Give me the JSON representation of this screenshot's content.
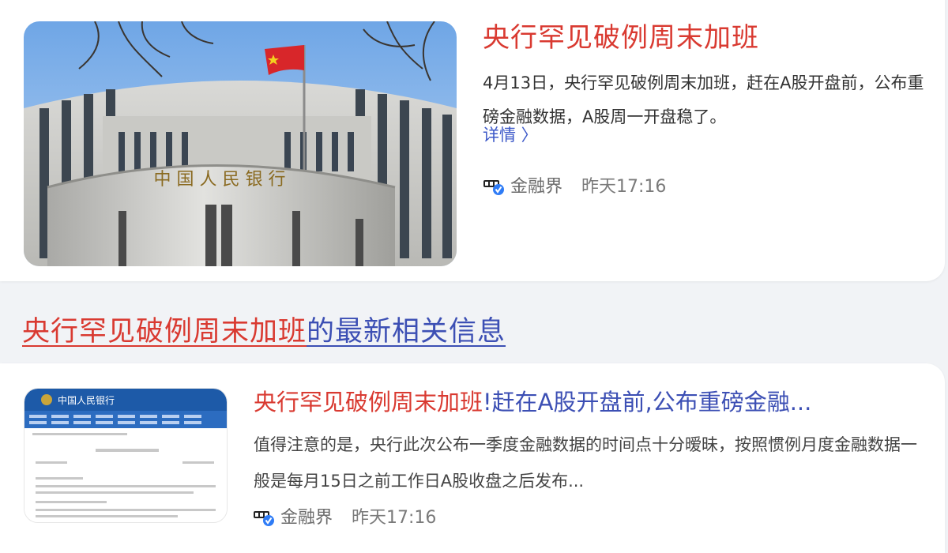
{
  "result1": {
    "title": "央行罕见破例周末加班",
    "summary": "4月13日，央行罕见破例周末加班，赶在A股开盘前，公布重磅金融数据，A股周一开盘稳了。",
    "detail_link": "详情 〉",
    "source": "金融界",
    "time": "昨天17:16",
    "image_sign_text": "中 国 人 民 银 行"
  },
  "section_heading": {
    "highlight": "央行罕见破例周末加班",
    "rest": "的最新相关信息"
  },
  "result2": {
    "title_highlight": "央行罕见破例周末加班",
    "title_rest": "!赶在A股开盘前,公布重磅金融...",
    "summary": "值得注意的是，央行此次公布一季度金融数据的时间点十分暧昧，按照惯例月度金融数据一般是每月15日之前工作日A股收盘之后发布...",
    "source": "金融界",
    "time": "昨天17:16",
    "thumb_header": "中国人民银行"
  },
  "colors": {
    "highlight_red": "#d93a31",
    "link_blue": "#3c4fb4",
    "detail_blue": "#3c58c8",
    "source_gray": "#6b6b6b",
    "verified_blue": "#2f7cf6"
  },
  "icons": {
    "verified": "verified-badge-icon",
    "source_logo": "jinrongjie-logo-icon",
    "chevron": "chevron-right-icon"
  }
}
